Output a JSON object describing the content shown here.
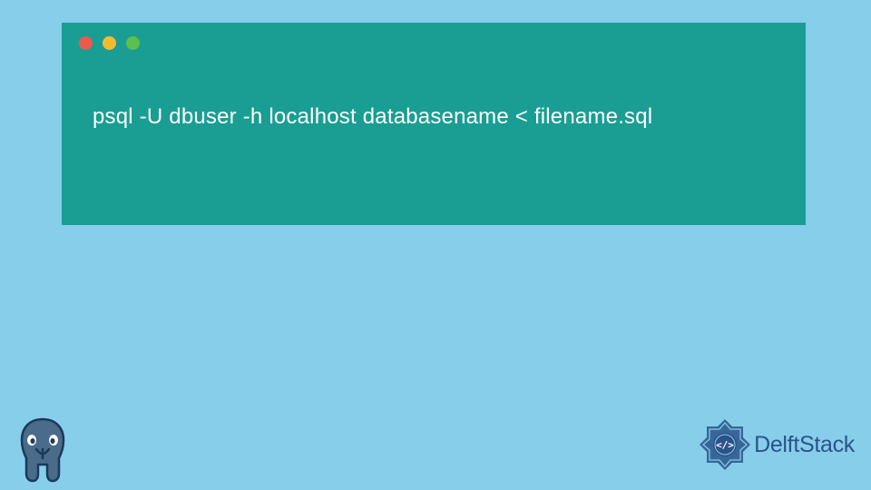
{
  "terminal": {
    "command": "psql -U dbuser -h localhost databasename < filename.sql"
  },
  "branding": {
    "site_name": "DelftStack"
  },
  "colors": {
    "background": "#87CEEB",
    "terminal_bg": "#1A9E94",
    "traffic_red": "#ED594A",
    "traffic_yellow": "#F5BB2F",
    "traffic_green": "#5AC14C",
    "brand_blue": "#2C5389"
  }
}
